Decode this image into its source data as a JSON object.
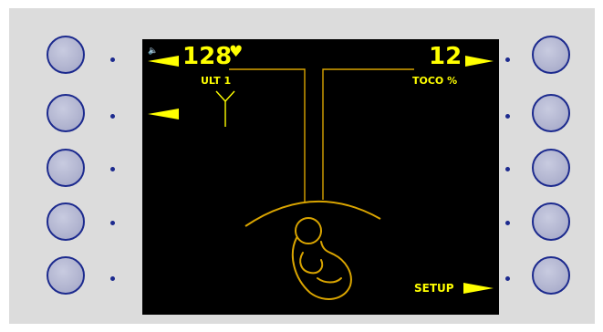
{
  "screen": {
    "fhr": {
      "value": "128",
      "heart_glyph": "♥",
      "source_label": "ULT 1"
    },
    "toco": {
      "value": "12",
      "label": "TOCO %"
    },
    "setup_label": "SETUP",
    "speaker_glyph": "🔈"
  },
  "icons": {
    "speaker": "speaker-icon",
    "heart": "heart-icon",
    "antenna": "antenna-icon",
    "fetus": "fetus-icon"
  },
  "colors": {
    "screen_bg": "#000000",
    "text": "#ffff00",
    "lines": "#d9a400",
    "button_border": "#1c2a8e",
    "device_bg": "#dcdcdc"
  }
}
